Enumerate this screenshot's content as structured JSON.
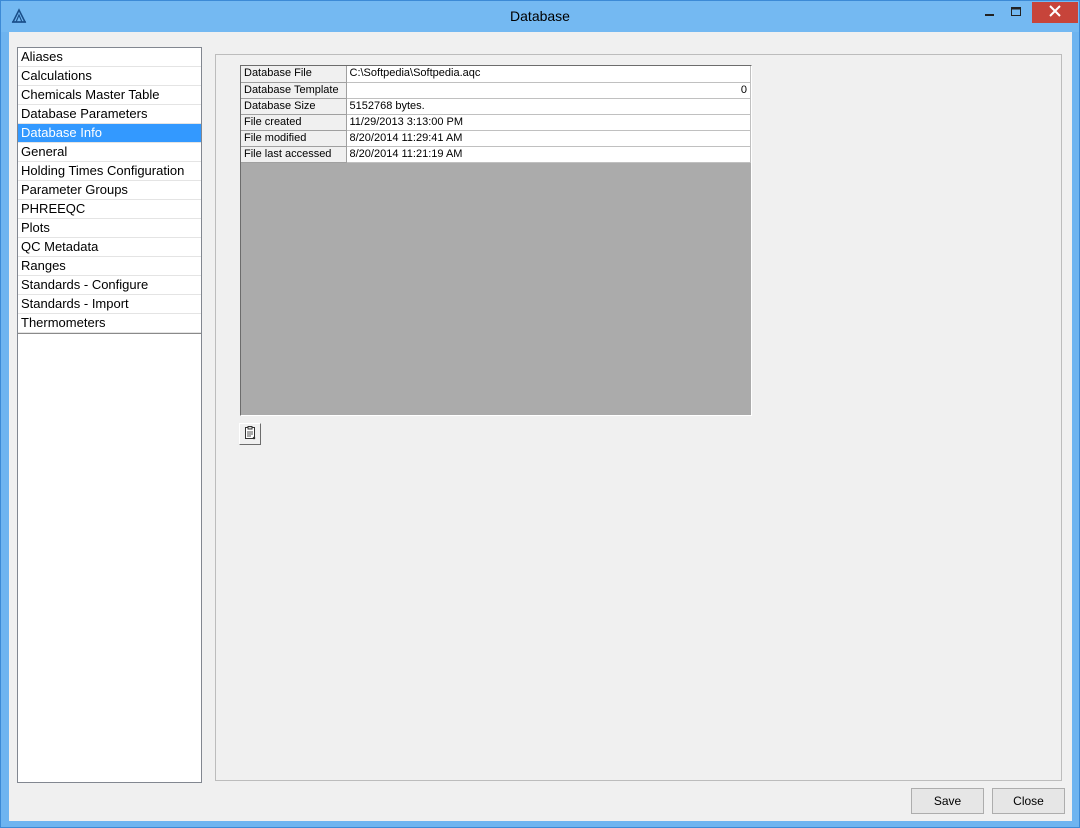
{
  "window": {
    "title": "Database",
    "title_bar_color": "#74b9f2",
    "close_button_color": "#c7443a",
    "icons": [
      "app-logo-icon",
      "minimize-icon",
      "maximize-icon",
      "close-icon"
    ]
  },
  "sidebar": {
    "selected_color": "#3399ff",
    "items": [
      {
        "label": "Aliases",
        "selected": false
      },
      {
        "label": "Calculations",
        "selected": false
      },
      {
        "label": "Chemicals Master Table",
        "selected": false
      },
      {
        "label": "Database Parameters",
        "selected": false
      },
      {
        "label": "Database Info",
        "selected": true
      },
      {
        "label": "General",
        "selected": false
      },
      {
        "label": "Holding Times Configuration",
        "selected": false
      },
      {
        "label": "Parameter Groups",
        "selected": false
      },
      {
        "label": "PHREEQC",
        "selected": false
      },
      {
        "label": "Plots",
        "selected": false
      },
      {
        "label": "QC Metadata",
        "selected": false
      },
      {
        "label": "Ranges",
        "selected": false
      },
      {
        "label": "Standards - Configure",
        "selected": false
      },
      {
        "label": "Standards - Import",
        "selected": false
      },
      {
        "label": "Thermometers",
        "selected": false
      }
    ]
  },
  "info_grid": {
    "rows": [
      {
        "key": "Database File",
        "value": "C:\\Softpedia\\Softpedia.aqc",
        "align": "left"
      },
      {
        "key": "Database Template",
        "value": "0",
        "align": "right"
      },
      {
        "key": "Database Size",
        "value": "5152768 bytes.",
        "align": "left"
      },
      {
        "key": "File created",
        "value": "11/29/2013 3:13:00 PM",
        "align": "left"
      },
      {
        "key": "File modified",
        "value": "8/20/2014 11:29:41 AM",
        "align": "left"
      },
      {
        "key": "File last accessed",
        "value": "8/20/2014 11:21:19 AM",
        "align": "left"
      }
    ]
  },
  "toolbar": {
    "copy_icon": "copy-clipboard-icon"
  },
  "footer": {
    "save_label": "Save",
    "close_label": "Close"
  }
}
